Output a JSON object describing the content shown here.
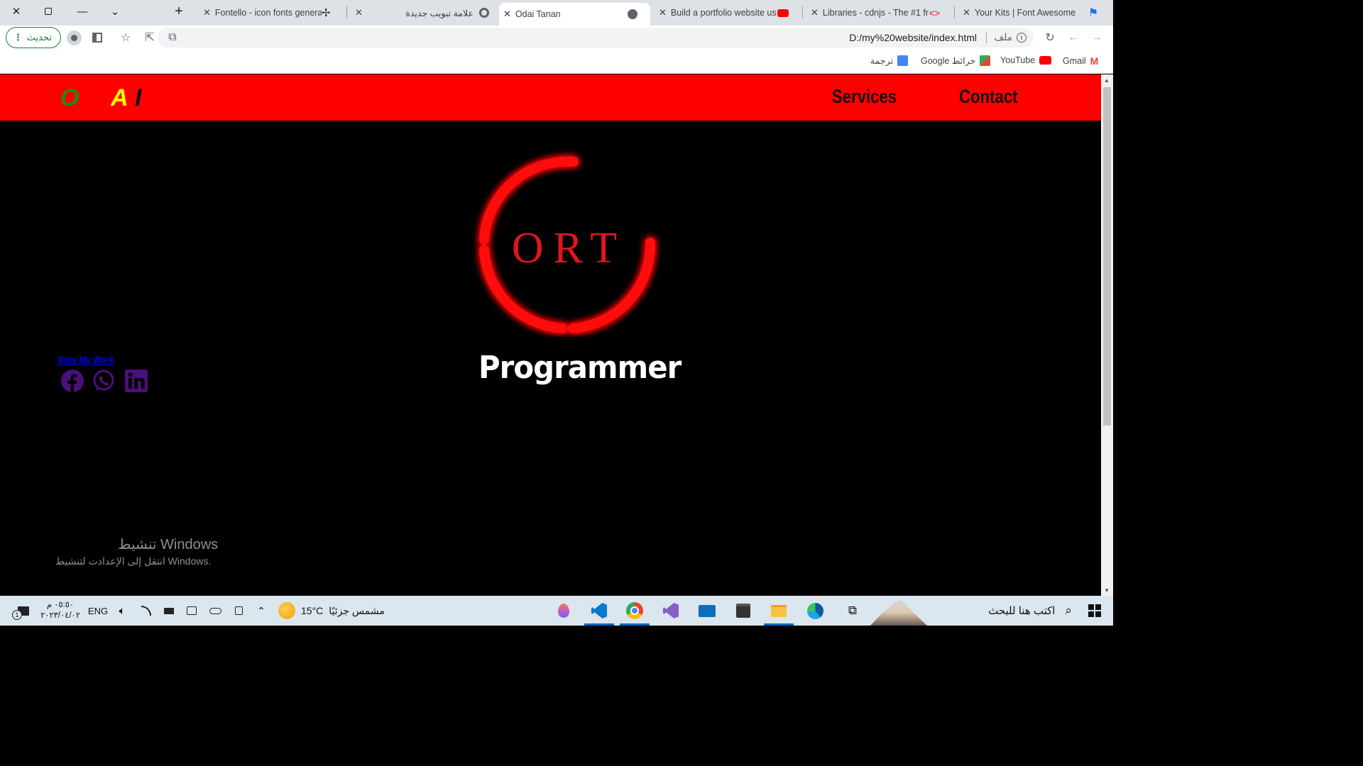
{
  "browser": {
    "tabs": [
      {
        "title": "Fontello - icon fonts genera"
      },
      {
        "title": "علامة تبويب جديدة"
      },
      {
        "title": "Odai Tanan"
      },
      {
        "title": "Build a portfolio website us"
      },
      {
        "title": "Libraries - cdnjs - The #1 fr"
      },
      {
        "title": "Your Kits | Font Awesome"
      }
    ],
    "update_label": "تحديث",
    "url": "D:/my%20website/index.html",
    "url_scheme_label": "ملف",
    "bookmarks": [
      {
        "label": "ترجمة"
      },
      {
        "label": "Google خرائط"
      },
      {
        "label": "YouTube"
      },
      {
        "label": "Gmail"
      }
    ]
  },
  "site": {
    "logo_letters": [
      "O",
      "A",
      "I"
    ],
    "nav": {
      "services": "Services",
      "contact": "Contact"
    },
    "hero_logo_text": "ORT",
    "hero_title": "Programmer",
    "view_work_label": "View My Work",
    "social_icons": [
      "facebook-icon",
      "whatsapp-icon",
      "linkedin-icon"
    ]
  },
  "windows_watermark": {
    "title": "تنشيط Windows",
    "subtitle": "انتقل إلى الإعدادت لتنشيط Windows."
  },
  "taskbar": {
    "time": "٠٥:٥٠ م",
    "date": "٢٠٢٣/٠٤/٠٢",
    "language": "ENG",
    "notification_count": "1",
    "weather_temp": "15°C",
    "weather_desc": "مشمس جزئيًا",
    "search_placeholder": "اكتب هنا للبحث"
  },
  "colors": {
    "header_red": "#ff0000",
    "logo_o": "#1a8c1a",
    "logo_a": "#ffff00",
    "social_purple": "#4b0f7a"
  }
}
